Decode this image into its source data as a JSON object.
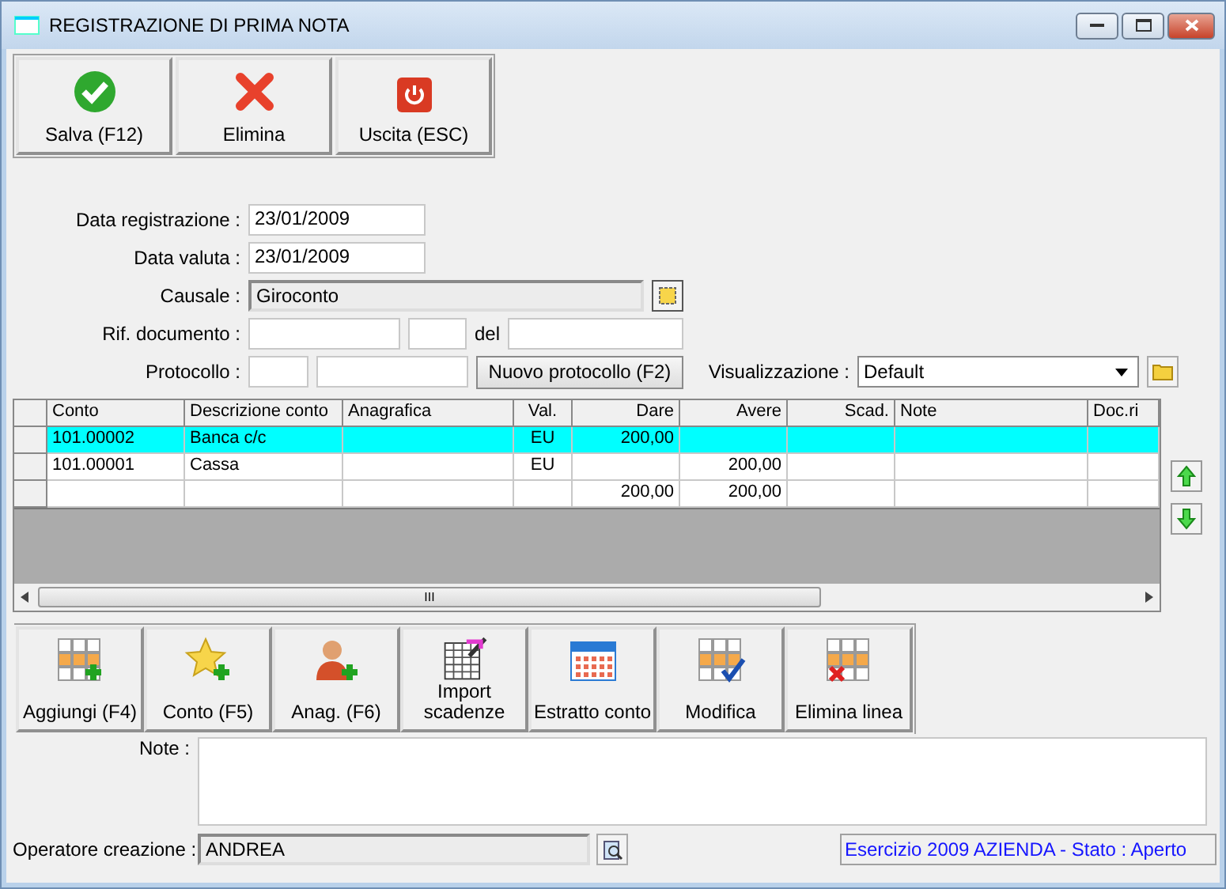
{
  "window": {
    "title": "REGISTRAZIONE DI PRIMA NOTA"
  },
  "toolbar": [
    {
      "label": "Salva (F12)",
      "kind": "check"
    },
    {
      "label": "Elimina",
      "kind": "cross"
    },
    {
      "label": "Uscita (ESC)",
      "kind": "power"
    }
  ],
  "form": {
    "data_registrazione": {
      "label": "Data registrazione :",
      "value": "23/01/2009"
    },
    "data_valuta": {
      "label": "Data valuta :",
      "value": "23/01/2009"
    },
    "causale": {
      "label": "Causale :",
      "value": "Giroconto"
    },
    "rif_documento": {
      "label": "Rif. documento :",
      "del_label": "del"
    },
    "protocollo": {
      "label": "Protocollo :",
      "button": "Nuovo protocollo (F2)"
    },
    "visualizzazione": {
      "label": "Visualizzazione :",
      "value": "Default"
    }
  },
  "grid": {
    "columns": [
      "Conto",
      "Descrizione conto",
      "Anagrafica",
      "Val.",
      "Dare",
      "Avere",
      "Scad.",
      "Note",
      "Doc.ri"
    ],
    "rows": [
      {
        "selected": true,
        "cells": [
          "101.00002",
          "Banca c/c",
          "",
          "EU",
          "200,00",
          "",
          "",
          "",
          ""
        ]
      },
      {
        "selected": false,
        "cells": [
          "101.00001",
          "Cassa",
          "",
          "EU",
          "",
          "200,00",
          "",
          "",
          ""
        ]
      },
      {
        "selected": false,
        "cells": [
          "",
          "",
          "",
          "",
          "200,00",
          "200,00",
          "",
          "",
          ""
        ]
      }
    ],
    "scroll_grip": "III"
  },
  "actions": [
    {
      "label": "Aggiungi (F4)",
      "kind": "grid-add"
    },
    {
      "label": "Conto (F5)",
      "kind": "star-add"
    },
    {
      "label": "Anag. (F6)",
      "kind": "person-add"
    },
    {
      "label": "Import\nscadenze",
      "kind": "sheet"
    },
    {
      "label": "Estratto conto",
      "kind": "calendar"
    },
    {
      "label": "Modifica",
      "kind": "grid-check"
    },
    {
      "label": "Elimina linea",
      "kind": "grid-delete"
    }
  ],
  "note": {
    "label": "Note :"
  },
  "operatore": {
    "label": "Operatore creazione :",
    "value": "ANDREA"
  },
  "status": "Esercizio 2009 AZIENDA - Stato : Aperto"
}
